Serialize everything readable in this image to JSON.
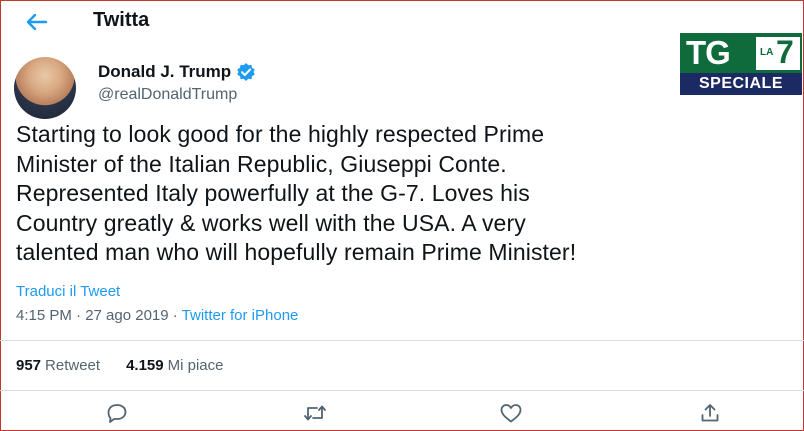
{
  "header": {
    "back_icon": "arrow-left-icon",
    "title": "Twitta"
  },
  "tweet": {
    "author_name": "Donald J. Trump",
    "verified_icon": "verified-badge-icon",
    "handle": "@realDonaldTrump",
    "lines": [
      "Starting to look good for the highly respected Prime",
      "Minister of the Italian Republic, Giuseppi Conte.",
      "Represented Italy powerfully at the G-7. Loves his",
      "Country greatly & works well with the USA. A very",
      "talented man who will hopefully remain Prime Minister!"
    ],
    "translate_link": "Traduci il Tweet",
    "timestamp": "4:15 PM · 27 ago 2019 · ",
    "source": "Twitter for iPhone"
  },
  "stats": {
    "retweets_count": "957",
    "retweets_label": "Retweet",
    "likes_count": "4.159",
    "likes_label": "Mi piace"
  },
  "actions": [
    "reply-icon",
    "retweet-icon",
    "like-icon",
    "share-icon"
  ],
  "overlay": {
    "tg": "TG",
    "la": "LA",
    "seven": "7",
    "speciale": "SPECIALE"
  },
  "colors": {
    "accent": "#1d9bf0",
    "logo_green": "#0f6b3c",
    "logo_navy": "#1b2a62"
  }
}
